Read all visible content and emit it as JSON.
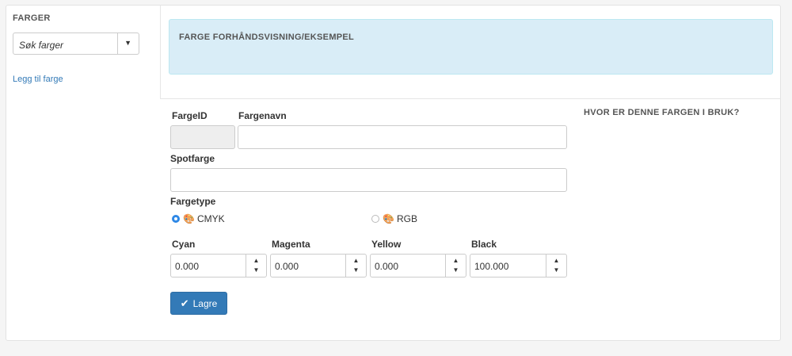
{
  "sidebar": {
    "title": "FARGER",
    "search_placeholder": "Søk farger",
    "add_link": "Legg til farge"
  },
  "preview": {
    "title": "FARGE FORHÅNDSVISNING/EKSEMPEL",
    "color": "#d9edf7"
  },
  "form": {
    "id_label": "FargeID",
    "id_value": "",
    "name_label": "Fargenavn",
    "name_value": "",
    "spot_label": "Spotfarge",
    "spot_value": "",
    "type_label": "Fargetype",
    "type_options": [
      {
        "label": "CMYK",
        "selected": true,
        "icon": "palette-icon"
      },
      {
        "label": "RGB",
        "selected": false,
        "icon": "palette-icon"
      }
    ],
    "channels": [
      {
        "label": "Cyan",
        "value": "0.000"
      },
      {
        "label": "Magenta",
        "value": "0.000"
      },
      {
        "label": "Yellow",
        "value": "0.000"
      },
      {
        "label": "Black",
        "value": "100.000"
      }
    ],
    "save_label": "Lagre",
    "save_icon": "check-icon"
  },
  "usage": {
    "title": "HVOR ER DENNE FARGEN I BRUK?"
  },
  "colors": {
    "accent": "#337ab7",
    "radio_selected": "#2e88e6"
  }
}
